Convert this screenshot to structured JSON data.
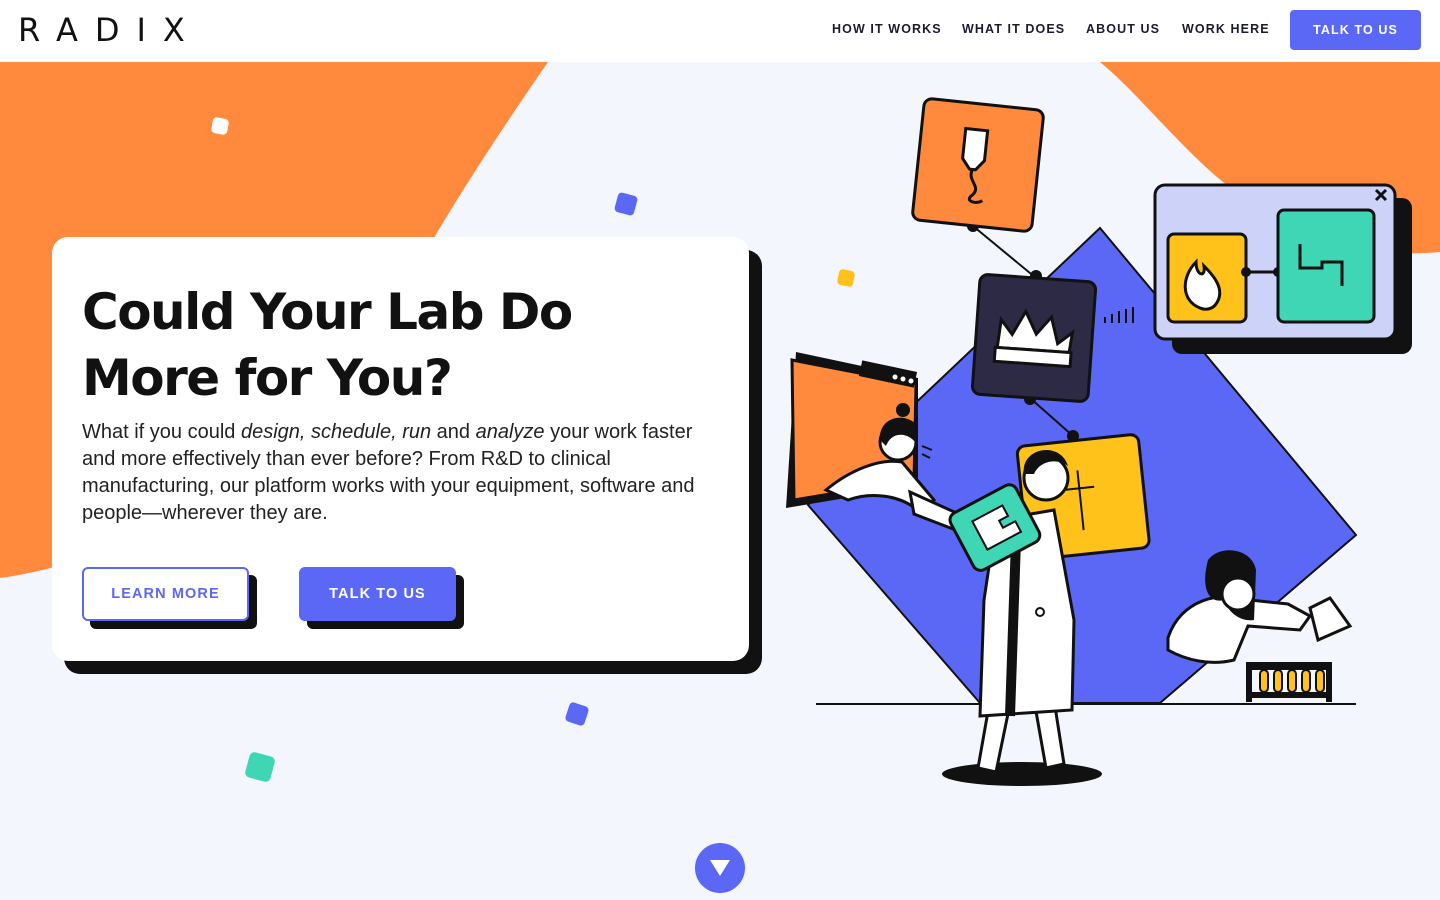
{
  "header": {
    "logo": "RADIX",
    "nav": [
      {
        "label": "HOW IT WORKS"
      },
      {
        "label": "WHAT IT DOES"
      },
      {
        "label": "ABOUT US"
      },
      {
        "label": "WORK HERE"
      }
    ],
    "cta": "TALK TO US"
  },
  "hero": {
    "headline": "Could Your Lab Do More for You?",
    "body": {
      "p1": "What if you could ",
      "em1": "design, schedule, run",
      "p2": " and ",
      "em2": "analyze",
      "p3": " your work faster and more effectively than ever before? From R&D to clinical manufacturing, our platform works with your equipment, software and people—wherever they are."
    },
    "learn_more": "LEARN MORE",
    "talk_to_us": "TALK TO US"
  },
  "colors": {
    "accent": "#5b67f5",
    "orange": "#ff8a3d",
    "teal": "#3ed6b4",
    "yellow": "#ffc21a",
    "dark": "#111111",
    "background": "#f4f6fd"
  },
  "icons": [
    "pipette-icon",
    "crown-icon",
    "flame-icon",
    "chart-step-icon",
    "close-icon",
    "chevron-down-icon"
  ]
}
